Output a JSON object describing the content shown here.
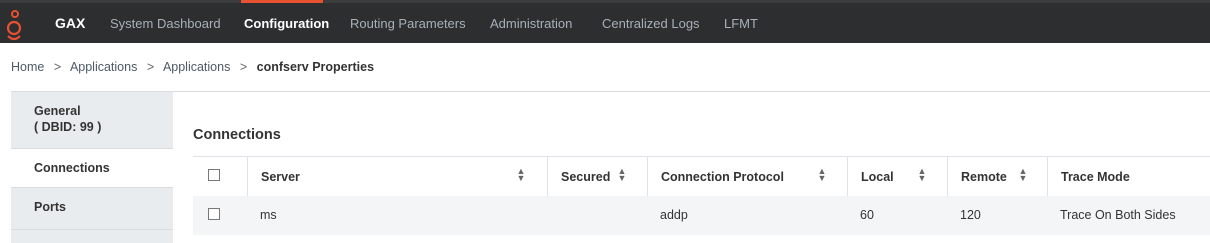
{
  "app": {
    "brand": "GAX",
    "accent_color": "#e8512f",
    "logo_icon": "genesys-logo-icon"
  },
  "nav": {
    "items": [
      {
        "label": "System Dashboard",
        "active": false
      },
      {
        "label": "Configuration",
        "active": true
      },
      {
        "label": "Routing Parameters",
        "active": false
      },
      {
        "label": "Administration",
        "active": false
      },
      {
        "label": "Centralized Logs",
        "active": false
      },
      {
        "label": "LFMT",
        "active": false
      }
    ]
  },
  "breadcrumb": {
    "items": [
      "Home",
      "Applications",
      "Applications"
    ],
    "separator": ">",
    "current": "confserv Properties"
  },
  "sidebar": {
    "items": [
      {
        "label": "General",
        "sub": "( DBID: 99 )"
      },
      {
        "label": "Connections",
        "selected": true
      },
      {
        "label": "Ports"
      }
    ]
  },
  "main": {
    "section_title": "Connections",
    "table": {
      "columns": [
        "Server",
        "Secured",
        "Connection Protocol",
        "Local",
        "Remote",
        "Trace Mode"
      ],
      "rows": [
        {
          "server": "ms",
          "secured": "",
          "protocol": "addp",
          "local": "60",
          "remote": "120",
          "trace_mode": "Trace On Both Sides"
        }
      ]
    }
  }
}
